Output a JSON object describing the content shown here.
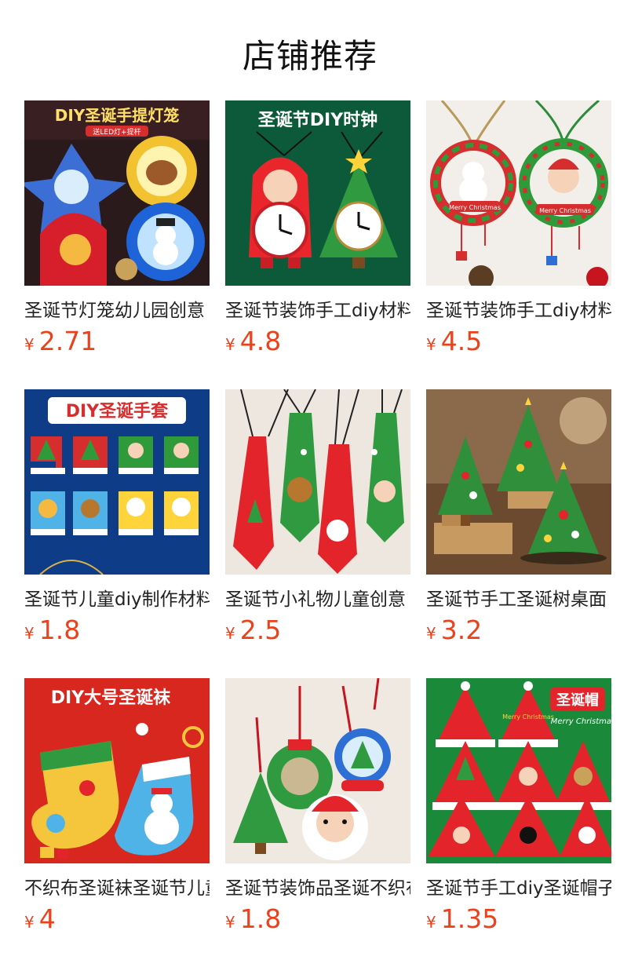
{
  "header": {
    "title": "店铺推荐"
  },
  "currency_symbol": "¥",
  "products": [
    {
      "title": "圣诞节灯笼幼儿园创意",
      "price": "2.71",
      "image": {
        "banner": "DIY圣诞手提灯笼",
        "sub": "送LED灯+提杆"
      }
    },
    {
      "title": "圣诞节装饰手工diy材料",
      "price": "4.8",
      "image": {
        "banner": "圣诞节DIY时钟"
      }
    },
    {
      "title": "圣诞节装饰手工diy材料",
      "price": "4.5",
      "image": {
        "tag1": "Merry Christmas",
        "tag2": "Merry Christmas"
      }
    },
    {
      "title": "圣诞节儿童diy制作材料",
      "price": "1.8",
      "image": {
        "banner": "DIY圣诞手套"
      }
    },
    {
      "title": "圣诞节小礼物儿童创意",
      "price": "2.5",
      "image": {}
    },
    {
      "title": "圣诞节手工圣诞树桌面",
      "price": "3.2",
      "image": {}
    },
    {
      "title": "不织布圣诞袜圣诞节儿童",
      "price": "4",
      "image": {
        "banner": "DIY大号圣诞袜"
      }
    },
    {
      "title": "圣诞节装饰品圣诞不织布",
      "price": "1.8",
      "image": {}
    },
    {
      "title": "圣诞节手工diy圣诞帽子",
      "price": "1.35",
      "image": {
        "banner": "圣诞帽",
        "script": "Merry Christmas",
        "hat": "Merry Christmas"
      }
    }
  ]
}
